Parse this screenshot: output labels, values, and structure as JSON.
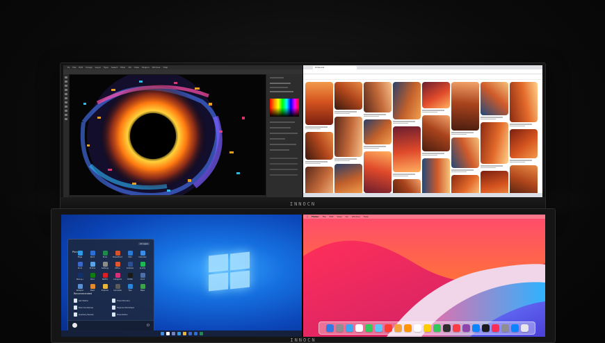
{
  "brand": "INNOCN",
  "top": {
    "photoshop": {
      "menu": [
        "Ps",
        "File",
        "Edit",
        "Image",
        "Layer",
        "Type",
        "Select",
        "Filter",
        "3D",
        "View",
        "Plugins",
        "Window",
        "Help"
      ]
    },
    "browser": {
      "tab_title": "Pinterest",
      "url": "pinterest.com/search/pins/?q=antelope canyon"
    }
  },
  "bottom": {
    "windows": {
      "pinned_label": "Pinned",
      "all_apps_label": "All apps",
      "recommended_label": "Recommended",
      "apps": [
        {
          "name": "Edge",
          "color": "#2f9be8"
        },
        {
          "name": "Word",
          "color": "#2b6fd6"
        },
        {
          "name": "Excel",
          "color": "#1f8a4c"
        },
        {
          "name": "PowerPoint",
          "color": "#d4532b"
        },
        {
          "name": "Mail",
          "color": "#2a7bd8"
        },
        {
          "name": "Calendar",
          "color": "#3b8ee6"
        },
        {
          "name": "Store",
          "color": "#3a67c9"
        },
        {
          "name": "Photos",
          "color": "#5aa3e8"
        },
        {
          "name": "Settings",
          "color": "#8c8c8c"
        },
        {
          "name": "Office",
          "color": "#e4572e"
        },
        {
          "name": "Solitaire",
          "color": "#2e4f8f"
        },
        {
          "name": "Spotify",
          "color": "#1db954"
        },
        {
          "name": "Disney+",
          "color": "#12306b"
        },
        {
          "name": "Xbox",
          "color": "#107c10"
        },
        {
          "name": "Netflix",
          "color": "#d81f26"
        },
        {
          "name": "Instagram",
          "color": "#d6307b"
        },
        {
          "name": "TikTok",
          "color": "#1a1a1a"
        },
        {
          "name": "Clock",
          "color": "#4e6fa8"
        },
        {
          "name": "Notepad",
          "color": "#5b8fd2"
        },
        {
          "name": "Paint",
          "color": "#e38b2c"
        },
        {
          "name": "Explorer",
          "color": "#e8b73a"
        },
        {
          "name": "Calculator",
          "color": "#5b5b5b"
        },
        {
          "name": "Tips",
          "color": "#2a86d8"
        },
        {
          "name": "Maps",
          "color": "#3fa34d"
        }
      ],
      "recommended": [
        {
          "name": "Get Started"
        },
        {
          "name": "Travel Itinerary"
        },
        {
          "name": "Brand Guidelines"
        },
        {
          "name": "Expense Worksheet"
        },
        {
          "name": "Quarterly Review"
        },
        {
          "name": "Presentation"
        }
      ],
      "taskbar_colors": [
        "#3a8ee8",
        "#ffffff",
        "#6f86c8",
        "#2f9be8",
        "#e8b73a",
        "#3a67c9",
        "#2b6fd6",
        "#1f8a4c"
      ]
    },
    "mac": {
      "menu": [
        "Finder",
        "File",
        "Edit",
        "View",
        "Go",
        "Window",
        "Help"
      ],
      "dock_colors": [
        "#2f7ae5",
        "#8e8e93",
        "#3ba7f0",
        "#ffffff",
        "#34c759",
        "#5ac8fa",
        "#ff3b30",
        "#f2a33a",
        "#ff9500",
        "#ffffff",
        "#ffcc00",
        "#34c759",
        "#2d2d2d",
        "#fc3c44",
        "#8e44ad",
        "#0a84ff",
        "#1c1c1e",
        "#ff2d55",
        "#8e8e93",
        "#0a84ff",
        "#e5e5ea"
      ]
    }
  }
}
